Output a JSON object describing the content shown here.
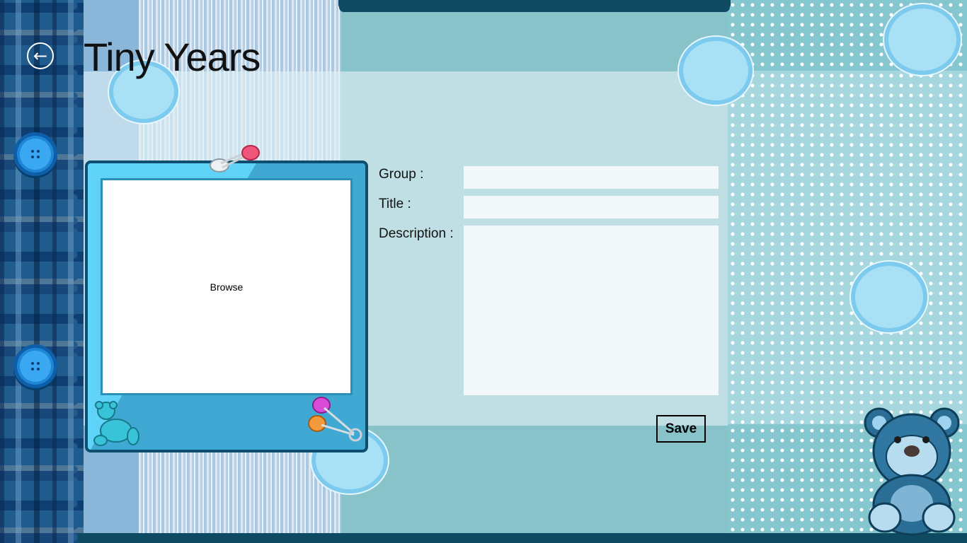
{
  "app": {
    "title": "Tiny Years"
  },
  "nav": {
    "back_icon": "back-arrow-icon",
    "back_glyph": "←"
  },
  "photo": {
    "browse_label": "Browse"
  },
  "form": {
    "group_label": "Group :",
    "group_value": "",
    "title_label": "Title :",
    "title_value": "",
    "description_label": "Description :",
    "description_value": "",
    "save_label": "Save"
  },
  "colors": {
    "accent": "#0f4a63",
    "button_blue": "#1f86d6",
    "card_blue": "#3fa9d3",
    "pin_pink": "#f0557a",
    "pin_magenta": "#d84bd8",
    "pin_orange": "#f39a3c"
  }
}
